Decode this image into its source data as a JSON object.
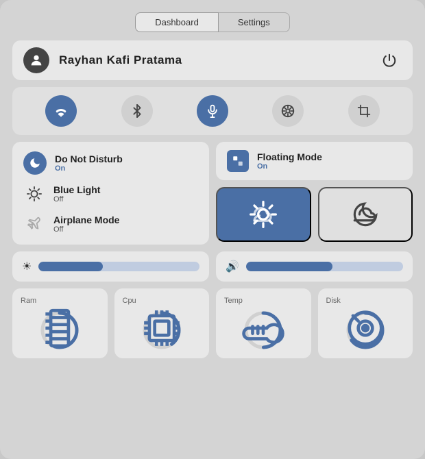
{
  "tabs": [
    {
      "id": "dashboard",
      "label": "Dashboard",
      "active": true
    },
    {
      "id": "settings",
      "label": "Settings",
      "active": false
    }
  ],
  "user": {
    "name": "Rayhan Kafi Pratama"
  },
  "quick_toggles": [
    {
      "id": "wifi",
      "icon": "▼",
      "symbol": "wifi",
      "active": true
    },
    {
      "id": "bluetooth",
      "icon": "⚡",
      "symbol": "bluetooth",
      "active": false
    },
    {
      "id": "mic",
      "icon": "🎙",
      "symbol": "microphone",
      "active": true
    },
    {
      "id": "camera",
      "icon": "◎",
      "symbol": "camera",
      "active": false
    },
    {
      "id": "crop",
      "icon": "⊡",
      "symbol": "crop",
      "active": false
    }
  ],
  "settings_items": [
    {
      "id": "do-not-disturb",
      "title": "Do Not Disturb",
      "status": "On",
      "status_on": true,
      "icon": "🌙",
      "icon_active": true
    },
    {
      "id": "blue-light",
      "title": "Blue Light",
      "status": "Off",
      "status_on": false,
      "icon": "💡",
      "icon_active": false
    },
    {
      "id": "airplane-mode",
      "title": "Airplane Mode",
      "status": "Off",
      "status_on": false,
      "icon": "✈",
      "icon_active": false
    }
  ],
  "floating_mode": {
    "title": "Floating Mode",
    "status": "On",
    "status_on": true
  },
  "weather": {
    "day_active": true,
    "night_active": false
  },
  "sliders": [
    {
      "id": "brightness",
      "icon": "☀",
      "fill_percent": 40
    },
    {
      "id": "volume",
      "icon": "🔊",
      "fill_percent": 55
    }
  ],
  "stats": [
    {
      "id": "ram",
      "label": "Ram",
      "icon": "🖥",
      "progress": 0.55
    },
    {
      "id": "cpu",
      "label": "Cpu",
      "icon": "💾",
      "progress": 0.4
    },
    {
      "id": "temp",
      "label": "Temp",
      "icon": "🌡",
      "progress": 0.5
    },
    {
      "id": "disk",
      "label": "Disk",
      "icon": "💿",
      "progress": 0.65
    }
  ],
  "colors": {
    "accent": "#4a6fa5",
    "bg_card": "#e8e8e8",
    "bg_main": "#d4d4d4"
  }
}
